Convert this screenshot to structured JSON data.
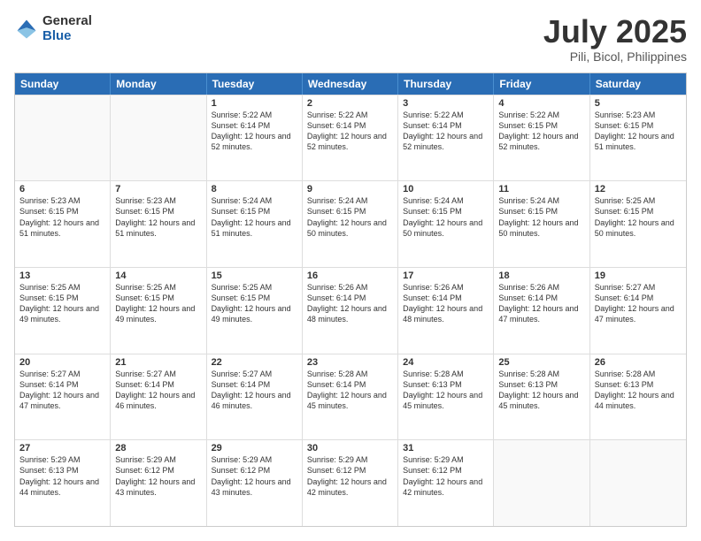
{
  "logo": {
    "general": "General",
    "blue": "Blue"
  },
  "header": {
    "month": "July 2025",
    "location": "Pili, Bicol, Philippines"
  },
  "weekdays": [
    "Sunday",
    "Monday",
    "Tuesday",
    "Wednesday",
    "Thursday",
    "Friday",
    "Saturday"
  ],
  "weeks": [
    [
      {
        "day": "",
        "sunrise": "",
        "sunset": "",
        "daylight": ""
      },
      {
        "day": "",
        "sunrise": "",
        "sunset": "",
        "daylight": ""
      },
      {
        "day": "1",
        "sunrise": "Sunrise: 5:22 AM",
        "sunset": "Sunset: 6:14 PM",
        "daylight": "Daylight: 12 hours and 52 minutes."
      },
      {
        "day": "2",
        "sunrise": "Sunrise: 5:22 AM",
        "sunset": "Sunset: 6:14 PM",
        "daylight": "Daylight: 12 hours and 52 minutes."
      },
      {
        "day": "3",
        "sunrise": "Sunrise: 5:22 AM",
        "sunset": "Sunset: 6:14 PM",
        "daylight": "Daylight: 12 hours and 52 minutes."
      },
      {
        "day": "4",
        "sunrise": "Sunrise: 5:22 AM",
        "sunset": "Sunset: 6:15 PM",
        "daylight": "Daylight: 12 hours and 52 minutes."
      },
      {
        "day": "5",
        "sunrise": "Sunrise: 5:23 AM",
        "sunset": "Sunset: 6:15 PM",
        "daylight": "Daylight: 12 hours and 51 minutes."
      }
    ],
    [
      {
        "day": "6",
        "sunrise": "Sunrise: 5:23 AM",
        "sunset": "Sunset: 6:15 PM",
        "daylight": "Daylight: 12 hours and 51 minutes."
      },
      {
        "day": "7",
        "sunrise": "Sunrise: 5:23 AM",
        "sunset": "Sunset: 6:15 PM",
        "daylight": "Daylight: 12 hours and 51 minutes."
      },
      {
        "day": "8",
        "sunrise": "Sunrise: 5:24 AM",
        "sunset": "Sunset: 6:15 PM",
        "daylight": "Daylight: 12 hours and 51 minutes."
      },
      {
        "day": "9",
        "sunrise": "Sunrise: 5:24 AM",
        "sunset": "Sunset: 6:15 PM",
        "daylight": "Daylight: 12 hours and 50 minutes."
      },
      {
        "day": "10",
        "sunrise": "Sunrise: 5:24 AM",
        "sunset": "Sunset: 6:15 PM",
        "daylight": "Daylight: 12 hours and 50 minutes."
      },
      {
        "day": "11",
        "sunrise": "Sunrise: 5:24 AM",
        "sunset": "Sunset: 6:15 PM",
        "daylight": "Daylight: 12 hours and 50 minutes."
      },
      {
        "day": "12",
        "sunrise": "Sunrise: 5:25 AM",
        "sunset": "Sunset: 6:15 PM",
        "daylight": "Daylight: 12 hours and 50 minutes."
      }
    ],
    [
      {
        "day": "13",
        "sunrise": "Sunrise: 5:25 AM",
        "sunset": "Sunset: 6:15 PM",
        "daylight": "Daylight: 12 hours and 49 minutes."
      },
      {
        "day": "14",
        "sunrise": "Sunrise: 5:25 AM",
        "sunset": "Sunset: 6:15 PM",
        "daylight": "Daylight: 12 hours and 49 minutes."
      },
      {
        "day": "15",
        "sunrise": "Sunrise: 5:25 AM",
        "sunset": "Sunset: 6:15 PM",
        "daylight": "Daylight: 12 hours and 49 minutes."
      },
      {
        "day": "16",
        "sunrise": "Sunrise: 5:26 AM",
        "sunset": "Sunset: 6:14 PM",
        "daylight": "Daylight: 12 hours and 48 minutes."
      },
      {
        "day": "17",
        "sunrise": "Sunrise: 5:26 AM",
        "sunset": "Sunset: 6:14 PM",
        "daylight": "Daylight: 12 hours and 48 minutes."
      },
      {
        "day": "18",
        "sunrise": "Sunrise: 5:26 AM",
        "sunset": "Sunset: 6:14 PM",
        "daylight": "Daylight: 12 hours and 47 minutes."
      },
      {
        "day": "19",
        "sunrise": "Sunrise: 5:27 AM",
        "sunset": "Sunset: 6:14 PM",
        "daylight": "Daylight: 12 hours and 47 minutes."
      }
    ],
    [
      {
        "day": "20",
        "sunrise": "Sunrise: 5:27 AM",
        "sunset": "Sunset: 6:14 PM",
        "daylight": "Daylight: 12 hours and 47 minutes."
      },
      {
        "day": "21",
        "sunrise": "Sunrise: 5:27 AM",
        "sunset": "Sunset: 6:14 PM",
        "daylight": "Daylight: 12 hours and 46 minutes."
      },
      {
        "day": "22",
        "sunrise": "Sunrise: 5:27 AM",
        "sunset": "Sunset: 6:14 PM",
        "daylight": "Daylight: 12 hours and 46 minutes."
      },
      {
        "day": "23",
        "sunrise": "Sunrise: 5:28 AM",
        "sunset": "Sunset: 6:14 PM",
        "daylight": "Daylight: 12 hours and 45 minutes."
      },
      {
        "day": "24",
        "sunrise": "Sunrise: 5:28 AM",
        "sunset": "Sunset: 6:13 PM",
        "daylight": "Daylight: 12 hours and 45 minutes."
      },
      {
        "day": "25",
        "sunrise": "Sunrise: 5:28 AM",
        "sunset": "Sunset: 6:13 PM",
        "daylight": "Daylight: 12 hours and 45 minutes."
      },
      {
        "day": "26",
        "sunrise": "Sunrise: 5:28 AM",
        "sunset": "Sunset: 6:13 PM",
        "daylight": "Daylight: 12 hours and 44 minutes."
      }
    ],
    [
      {
        "day": "27",
        "sunrise": "Sunrise: 5:29 AM",
        "sunset": "Sunset: 6:13 PM",
        "daylight": "Daylight: 12 hours and 44 minutes."
      },
      {
        "day": "28",
        "sunrise": "Sunrise: 5:29 AM",
        "sunset": "Sunset: 6:12 PM",
        "daylight": "Daylight: 12 hours and 43 minutes."
      },
      {
        "day": "29",
        "sunrise": "Sunrise: 5:29 AM",
        "sunset": "Sunset: 6:12 PM",
        "daylight": "Daylight: 12 hours and 43 minutes."
      },
      {
        "day": "30",
        "sunrise": "Sunrise: 5:29 AM",
        "sunset": "Sunset: 6:12 PM",
        "daylight": "Daylight: 12 hours and 42 minutes."
      },
      {
        "day": "31",
        "sunrise": "Sunrise: 5:29 AM",
        "sunset": "Sunset: 6:12 PM",
        "daylight": "Daylight: 12 hours and 42 minutes."
      },
      {
        "day": "",
        "sunrise": "",
        "sunset": "",
        "daylight": ""
      },
      {
        "day": "",
        "sunrise": "",
        "sunset": "",
        "daylight": ""
      }
    ]
  ]
}
